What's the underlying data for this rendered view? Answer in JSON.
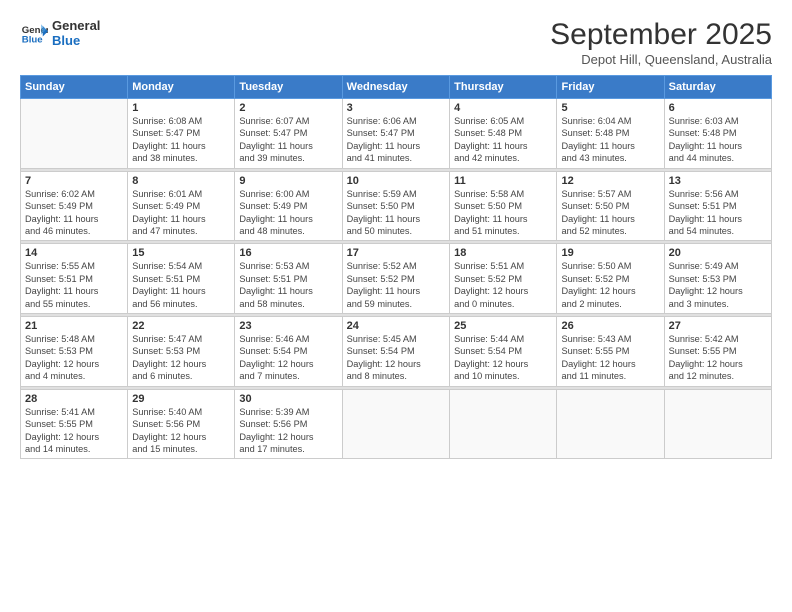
{
  "logo": {
    "line1": "General",
    "line2": "Blue"
  },
  "title": "September 2025",
  "subtitle": "Depot Hill, Queensland, Australia",
  "days_header": [
    "Sunday",
    "Monday",
    "Tuesday",
    "Wednesday",
    "Thursday",
    "Friday",
    "Saturday"
  ],
  "weeks": [
    [
      {
        "num": "",
        "info": ""
      },
      {
        "num": "1",
        "info": "Sunrise: 6:08 AM\nSunset: 5:47 PM\nDaylight: 11 hours\nand 38 minutes."
      },
      {
        "num": "2",
        "info": "Sunrise: 6:07 AM\nSunset: 5:47 PM\nDaylight: 11 hours\nand 39 minutes."
      },
      {
        "num": "3",
        "info": "Sunrise: 6:06 AM\nSunset: 5:47 PM\nDaylight: 11 hours\nand 41 minutes."
      },
      {
        "num": "4",
        "info": "Sunrise: 6:05 AM\nSunset: 5:48 PM\nDaylight: 11 hours\nand 42 minutes."
      },
      {
        "num": "5",
        "info": "Sunrise: 6:04 AM\nSunset: 5:48 PM\nDaylight: 11 hours\nand 43 minutes."
      },
      {
        "num": "6",
        "info": "Sunrise: 6:03 AM\nSunset: 5:48 PM\nDaylight: 11 hours\nand 44 minutes."
      }
    ],
    [
      {
        "num": "7",
        "info": "Sunrise: 6:02 AM\nSunset: 5:49 PM\nDaylight: 11 hours\nand 46 minutes."
      },
      {
        "num": "8",
        "info": "Sunrise: 6:01 AM\nSunset: 5:49 PM\nDaylight: 11 hours\nand 47 minutes."
      },
      {
        "num": "9",
        "info": "Sunrise: 6:00 AM\nSunset: 5:49 PM\nDaylight: 11 hours\nand 48 minutes."
      },
      {
        "num": "10",
        "info": "Sunrise: 5:59 AM\nSunset: 5:50 PM\nDaylight: 11 hours\nand 50 minutes."
      },
      {
        "num": "11",
        "info": "Sunrise: 5:58 AM\nSunset: 5:50 PM\nDaylight: 11 hours\nand 51 minutes."
      },
      {
        "num": "12",
        "info": "Sunrise: 5:57 AM\nSunset: 5:50 PM\nDaylight: 11 hours\nand 52 minutes."
      },
      {
        "num": "13",
        "info": "Sunrise: 5:56 AM\nSunset: 5:51 PM\nDaylight: 11 hours\nand 54 minutes."
      }
    ],
    [
      {
        "num": "14",
        "info": "Sunrise: 5:55 AM\nSunset: 5:51 PM\nDaylight: 11 hours\nand 55 minutes."
      },
      {
        "num": "15",
        "info": "Sunrise: 5:54 AM\nSunset: 5:51 PM\nDaylight: 11 hours\nand 56 minutes."
      },
      {
        "num": "16",
        "info": "Sunrise: 5:53 AM\nSunset: 5:51 PM\nDaylight: 11 hours\nand 58 minutes."
      },
      {
        "num": "17",
        "info": "Sunrise: 5:52 AM\nSunset: 5:52 PM\nDaylight: 11 hours\nand 59 minutes."
      },
      {
        "num": "18",
        "info": "Sunrise: 5:51 AM\nSunset: 5:52 PM\nDaylight: 12 hours\nand 0 minutes."
      },
      {
        "num": "19",
        "info": "Sunrise: 5:50 AM\nSunset: 5:52 PM\nDaylight: 12 hours\nand 2 minutes."
      },
      {
        "num": "20",
        "info": "Sunrise: 5:49 AM\nSunset: 5:53 PM\nDaylight: 12 hours\nand 3 minutes."
      }
    ],
    [
      {
        "num": "21",
        "info": "Sunrise: 5:48 AM\nSunset: 5:53 PM\nDaylight: 12 hours\nand 4 minutes."
      },
      {
        "num": "22",
        "info": "Sunrise: 5:47 AM\nSunset: 5:53 PM\nDaylight: 12 hours\nand 6 minutes."
      },
      {
        "num": "23",
        "info": "Sunrise: 5:46 AM\nSunset: 5:54 PM\nDaylight: 12 hours\nand 7 minutes."
      },
      {
        "num": "24",
        "info": "Sunrise: 5:45 AM\nSunset: 5:54 PM\nDaylight: 12 hours\nand 8 minutes."
      },
      {
        "num": "25",
        "info": "Sunrise: 5:44 AM\nSunset: 5:54 PM\nDaylight: 12 hours\nand 10 minutes."
      },
      {
        "num": "26",
        "info": "Sunrise: 5:43 AM\nSunset: 5:55 PM\nDaylight: 12 hours\nand 11 minutes."
      },
      {
        "num": "27",
        "info": "Sunrise: 5:42 AM\nSunset: 5:55 PM\nDaylight: 12 hours\nand 12 minutes."
      }
    ],
    [
      {
        "num": "28",
        "info": "Sunrise: 5:41 AM\nSunset: 5:55 PM\nDaylight: 12 hours\nand 14 minutes."
      },
      {
        "num": "29",
        "info": "Sunrise: 5:40 AM\nSunset: 5:56 PM\nDaylight: 12 hours\nand 15 minutes."
      },
      {
        "num": "30",
        "info": "Sunrise: 5:39 AM\nSunset: 5:56 PM\nDaylight: 12 hours\nand 17 minutes."
      },
      {
        "num": "",
        "info": ""
      },
      {
        "num": "",
        "info": ""
      },
      {
        "num": "",
        "info": ""
      },
      {
        "num": "",
        "info": ""
      }
    ]
  ]
}
